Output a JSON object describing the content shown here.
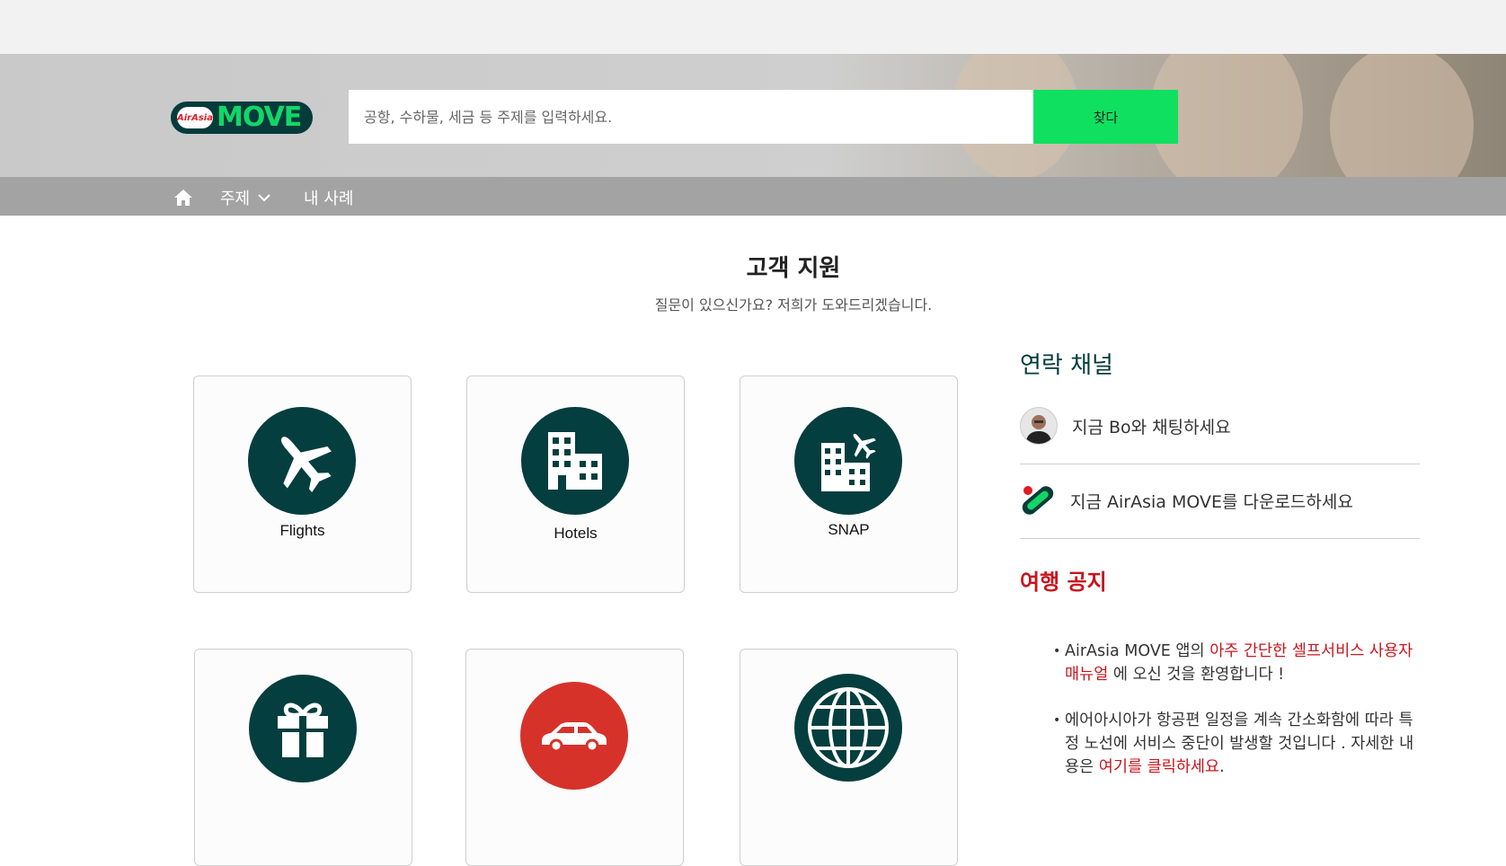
{
  "header": {
    "logo_small": "AirAsia",
    "logo_word": "MOVE",
    "search_placeholder": "공항, 수하물, 세금 등 주제를 입력하세요.",
    "search_button": "찾다"
  },
  "nav": {
    "topics_label": "주제",
    "cases_label": "내 사례"
  },
  "main": {
    "title": "고객 지원",
    "subtitle": "질문이 있으신가요? 저희가 도와드리겠습니다."
  },
  "categories": [
    {
      "label": "Flights",
      "icon": "airplane-icon"
    },
    {
      "label": "Hotels",
      "icon": "buildings-icon"
    },
    {
      "label": "SNAP",
      "icon": "snap-icon"
    },
    {
      "label": "",
      "icon": "gift-icon"
    },
    {
      "label": "",
      "icon": "car-icon"
    },
    {
      "label": "",
      "icon": "globe-icon"
    }
  ],
  "sidebar": {
    "contact_title": "연락 채널",
    "chat_label": "지금 Bo와 채팅하세요",
    "download_label": "지금 AirAsia MOVE를 다운로드하세요",
    "notice_title": "여행 공지",
    "notice1_pre": "AirAsia MOVE 앱의 ",
    "notice1_link": "아주 간단한 셀프서비스 사용자 매뉴얼",
    "notice1_post": " 에 오신 것을 환영합니다 !",
    "notice2_pre": "에어아시아가 항공편 일정을 계속 간소화함에 따라 특정 노선에 서비스 중단이 발생할 것입니다 . 자세한 내용은 ",
    "notice2_link": "여기를 클릭하세요",
    "notice2_post": "."
  },
  "colors": {
    "accent_green": "#10e060",
    "dark_teal": "#053e3e",
    "notice_red": "#c8161d"
  }
}
